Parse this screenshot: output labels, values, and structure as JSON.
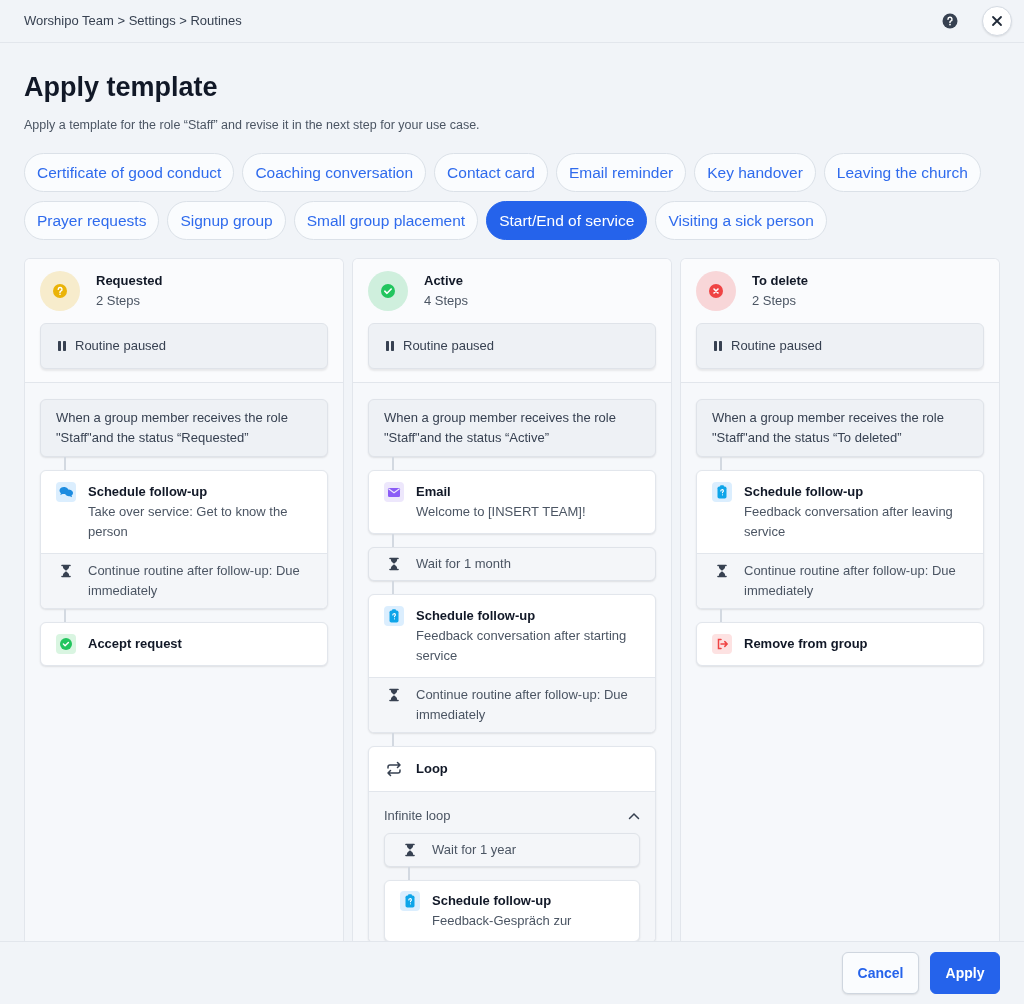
{
  "breadcrumb": "Worshipo Team > Settings > Routines",
  "title": "Apply template",
  "subtitle": "Apply a template for the role “Staff” and revise it in the next step for your use case.",
  "templates": [
    {
      "label": "Certificate of good conduct",
      "selected": false
    },
    {
      "label": "Coaching conversation",
      "selected": false
    },
    {
      "label": "Contact card",
      "selected": false
    },
    {
      "label": "Email reminder",
      "selected": false
    },
    {
      "label": "Key handover",
      "selected": false
    },
    {
      "label": "Leaving the church",
      "selected": false
    },
    {
      "label": "Prayer requests",
      "selected": false
    },
    {
      "label": "Signup group",
      "selected": false
    },
    {
      "label": "Small group placement",
      "selected": false
    },
    {
      "label": "Start/End of service",
      "selected": true
    },
    {
      "label": "Visiting a sick person",
      "selected": false
    }
  ],
  "columns": [
    {
      "color": "#eab308",
      "title": "Requested",
      "steps_count": "2 Steps",
      "paused": "Routine paused",
      "trigger": "When a group member receives the role \"Staff\"and the status “Requested”",
      "steps": [
        {
          "kind": "followup",
          "title": "Schedule follow-up",
          "text": "Take over service: Get to know the person",
          "continue": "Continue routine after follow-up: Due immediately"
        },
        {
          "kind": "action",
          "title": "Accept request"
        }
      ]
    },
    {
      "color": "#22c55e",
      "title": "Active",
      "steps_count": "4 Steps",
      "paused": "Routine paused",
      "trigger": "When a group member receives the role \"Staff\"and the status “Active”",
      "steps": [
        {
          "kind": "email",
          "title": "Email",
          "text": "Welcome to [INSERT TEAM]!"
        },
        {
          "kind": "wait",
          "text": "Wait for 1 month"
        },
        {
          "kind": "followup",
          "title": "Schedule follow-up",
          "text": "Feedback conversation after starting service",
          "continue": "Continue routine after follow-up: Due immediately"
        },
        {
          "kind": "loop",
          "title": "Loop",
          "subtitle": "Infinite loop",
          "expanded": true,
          "children": [
            {
              "kind": "wait",
              "text": "Wait for 1 year"
            },
            {
              "kind": "followup",
              "title": "Schedule follow-up",
              "text": "Feedback-Gespräch zur"
            }
          ]
        }
      ]
    },
    {
      "color": "#ef4444",
      "title": "To delete",
      "steps_count": "2 Steps",
      "paused": "Routine paused",
      "trigger": "When a group member receives the role \"Staff\"and the status “To deleted”",
      "steps": [
        {
          "kind": "followup",
          "title": "Schedule follow-up",
          "text": "Feedback conversation after leaving service",
          "continue": "Continue routine after follow-up: Due immediately"
        },
        {
          "kind": "action",
          "title": "Remove from group"
        }
      ]
    }
  ],
  "buttons": {
    "cancel": "Cancel",
    "apply": "Apply"
  }
}
